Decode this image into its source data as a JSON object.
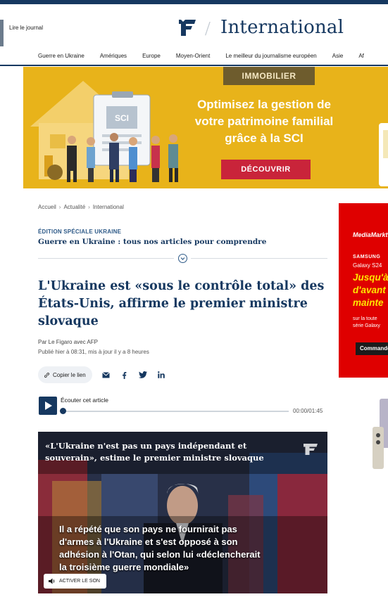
{
  "header": {
    "journal_link": "Lire le journal",
    "section_title": "International",
    "separator": "/"
  },
  "nav": {
    "items": [
      "Guerre en Ukraine",
      "Amériques",
      "Europe",
      "Moyen-Orient",
      "Le meilleur du journalisme européen",
      "Asie",
      "Af"
    ]
  },
  "banner_ad": {
    "tag": "IMMOBILIER",
    "headline_lines": [
      "Optimisez la gestion de",
      "votre patrimoine familial",
      "grâce à la SCI"
    ],
    "sign_text": "SCI",
    "cta": "DÉCOUVRIR",
    "colors": {
      "background": "#e8b31a",
      "tag": "#6e5c2d",
      "cta": "#c9243a"
    }
  },
  "breadcrumb": [
    "Accueil",
    "Actualité",
    "International"
  ],
  "special": {
    "label": "ÉDITION SPÉCIALE UKRAINE",
    "link": "Guerre en Ukraine : tous nos articles pour comprendre"
  },
  "article": {
    "title_lines": [
      "L'Ukraine est «sous le contrôle total» des",
      "États-Unis, affirme le premier ministre",
      "slovaque"
    ],
    "byline": "Par Le Figaro avec AFP",
    "published": "Publié hier à 08:31, mis à jour il y a 8 heures"
  },
  "share": {
    "copy_label": "Copier le lien",
    "icons": [
      "mail-icon",
      "facebook-icon",
      "twitter-icon",
      "linkedin-icon"
    ]
  },
  "audio": {
    "title": "Écouter cet article",
    "time": "00:00/01:45",
    "progress": 0
  },
  "video": {
    "quote_lines": [
      "«L'Ukraine n'est pas un pays indépendant et",
      "souverain», estime le premier ministre slovaque"
    ],
    "caption_lines": [
      "Il a répété que son pays ne fournirait pas",
      "d'armes à l'Ukraine et s'est opposé à son",
      "adhésion à l'Otan, qui selon lui «déclencherait",
      "la troisième guerre mondiale»"
    ],
    "sound_button": "ACTIVER LE SON"
  },
  "side_ad": {
    "brand": "MediaMarkt",
    "samsung": "SAMSUNG",
    "galaxy": "Galaxy S24",
    "promo_lines": [
      "Jusqu'à",
      "d'avant",
      "mainte"
    ],
    "small_lines": [
      "sur la toute",
      "série Galaxy"
    ],
    "cta": "Commande",
    "colors": {
      "background": "#df0000",
      "promo": "#ffe600"
    }
  },
  "colors": {
    "brand_navy": "#163860",
    "accent_blue": "#2e5a88"
  }
}
